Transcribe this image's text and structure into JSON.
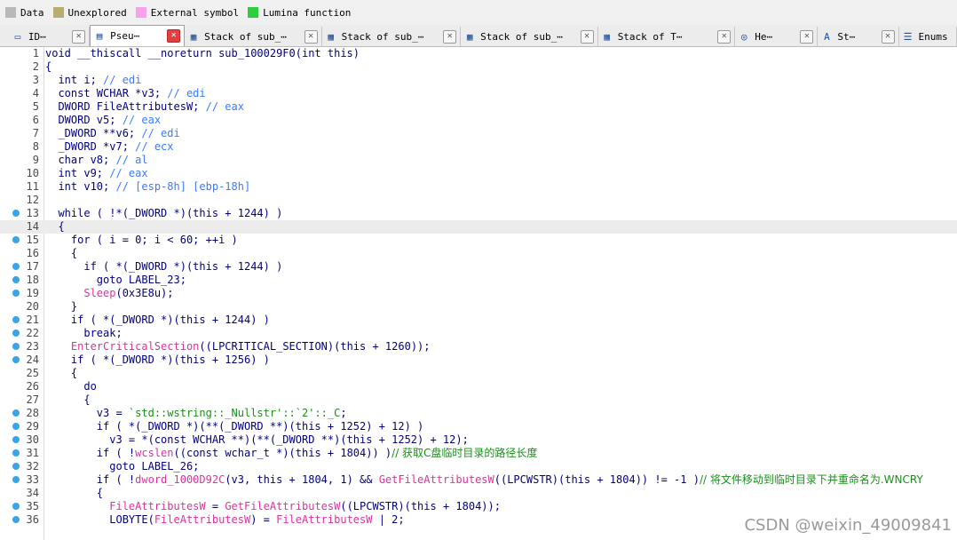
{
  "legend": [
    {
      "label": "Data",
      "color": "#b9b9b9"
    },
    {
      "label": "Unexplored",
      "color": "#b8ad6e"
    },
    {
      "label": "External symbol",
      "color": "#f7a0f0"
    },
    {
      "label": "Lumina function",
      "color": "#2ecc40"
    }
  ],
  "tabs": [
    {
      "label": "ID⋯",
      "icon": "ida-view-icon",
      "active": false
    },
    {
      "label": "Pseu⋯",
      "icon": "pseudocode-icon",
      "active": true
    },
    {
      "label": "Stack of sub_⋯",
      "icon": "stack-icon",
      "active": false
    },
    {
      "label": "Stack of sub_⋯",
      "icon": "stack-icon",
      "active": false
    },
    {
      "label": "Stack of sub_⋯",
      "icon": "stack-icon",
      "active": false
    },
    {
      "label": "Stack of T⋯",
      "icon": "stack-icon",
      "active": false
    },
    {
      "label": "He⋯",
      "icon": "hex-view-icon",
      "active": false
    },
    {
      "label": "St⋯",
      "icon": "strings-icon",
      "active": false
    },
    {
      "label": "Enums",
      "icon": "enums-icon",
      "active": false
    }
  ],
  "code_lines": [
    {
      "n": "1",
      "dot": false,
      "hl": false,
      "text": "void __thiscall __noreturn sub_100029F0(int this)"
    },
    {
      "n": "2",
      "dot": false,
      "hl": false,
      "text": "{"
    },
    {
      "n": "3",
      "dot": false,
      "hl": false,
      "text": "  int i; ",
      "cmt": "// edi"
    },
    {
      "n": "4",
      "dot": false,
      "hl": false,
      "text": "  const WCHAR *v3; ",
      "cmt": "// edi"
    },
    {
      "n": "5",
      "dot": false,
      "hl": false,
      "text": "  DWORD FileAttributesW; ",
      "cmt": "// eax"
    },
    {
      "n": "6",
      "dot": false,
      "hl": false,
      "text": "  DWORD v5; ",
      "cmt": "// eax"
    },
    {
      "n": "7",
      "dot": false,
      "hl": false,
      "text": "  _DWORD **v6; ",
      "cmt": "// edi"
    },
    {
      "n": "8",
      "dot": false,
      "hl": false,
      "text": "  _DWORD *v7; ",
      "cmt": "// ecx"
    },
    {
      "n": "9",
      "dot": false,
      "hl": false,
      "text": "  char v8; ",
      "cmt": "// al"
    },
    {
      "n": "10",
      "dot": false,
      "hl": false,
      "text": "  int v9; ",
      "cmt": "// eax"
    },
    {
      "n": "11",
      "dot": false,
      "hl": false,
      "text": "  int v10; ",
      "cmt": "// [esp-8h] [ebp-18h]"
    },
    {
      "n": "12",
      "dot": false,
      "hl": false,
      "text": ""
    },
    {
      "n": "13",
      "dot": true,
      "hl": false,
      "text": "  while ( !*(_DWORD *)(this + 1244) )"
    },
    {
      "n": "14",
      "dot": false,
      "hl": true,
      "text": "  {"
    },
    {
      "n": "15",
      "dot": true,
      "hl": false,
      "text": "    for ( i = 0; i < 60; ++i )"
    },
    {
      "n": "16",
      "dot": false,
      "hl": false,
      "text": "    {"
    },
    {
      "n": "17",
      "dot": true,
      "hl": false,
      "text": "      if ( *(_DWORD *)(this + 1244) )"
    },
    {
      "n": "18",
      "dot": true,
      "hl": false,
      "text": "        goto LABEL_23;"
    },
    {
      "n": "19",
      "dot": true,
      "hl": false,
      "pre": "      ",
      "fn": "Sleep",
      "text": "(0x3E8u);"
    },
    {
      "n": "20",
      "dot": false,
      "hl": false,
      "text": "    }"
    },
    {
      "n": "21",
      "dot": true,
      "hl": false,
      "text": "    if ( *(_DWORD *)(this + 1244) )"
    },
    {
      "n": "22",
      "dot": true,
      "hl": false,
      "text": "      break;"
    },
    {
      "n": "23",
      "dot": true,
      "hl": false,
      "pre": "    ",
      "fn": "EnterCriticalSection",
      "text": "((LPCRITICAL_SECTION)(this + 1260));"
    },
    {
      "n": "24",
      "dot": true,
      "hl": false,
      "text": "    if ( *(_DWORD *)(this + 1256) )"
    },
    {
      "n": "25",
      "dot": false,
      "hl": false,
      "text": "    {"
    },
    {
      "n": "26",
      "dot": false,
      "hl": false,
      "text": "      do"
    },
    {
      "n": "27",
      "dot": false,
      "hl": false,
      "text": "      {"
    },
    {
      "n": "28",
      "dot": true,
      "hl": false,
      "text": "        v3 = ",
      "str": "`std::wstring::_Nullstr'::`2'::_C",
      "tail": ";"
    },
    {
      "n": "29",
      "dot": true,
      "hl": false,
      "text": "        if ( *(_DWORD *)(**(_DWORD **)(this + 1252) + 12) )"
    },
    {
      "n": "30",
      "dot": true,
      "hl": false,
      "text": "          v3 = *(const WCHAR **)(**(_DWORD **)(this + 1252) + 12);"
    },
    {
      "n": "31",
      "dot": true,
      "hl": false,
      "pre": "        if ( !",
      "fn": "wcslen",
      "text": "((const wchar_t *)(this + 1804)) )",
      "zh": "// 获取C盘临时目录的路径长度"
    },
    {
      "n": "32",
      "dot": true,
      "hl": false,
      "text": "          goto LABEL_26;"
    },
    {
      "n": "33",
      "dot": true,
      "hl": false,
      "pre": "        if ( !",
      "fn": "dword_1000D92C",
      "text": "(v3, this + 1804, 1) && ",
      "fn2": "GetFileAttributesW",
      "text2": "((LPCWSTR)(this + 1804)) != -1 )",
      "zh": "// 将文件移动到临时目录下并重命名为.WNCRY"
    },
    {
      "n": "34",
      "dot": false,
      "hl": false,
      "text": "        {"
    },
    {
      "n": "35",
      "dot": true,
      "hl": false,
      "pre": "          ",
      "fn": "FileAttributesW",
      "text": " = ",
      "fn2": "GetFileAttributesW",
      "text2": "((LPCWSTR)(this + 1804));"
    },
    {
      "n": "36",
      "dot": true,
      "hl": false,
      "pre": "          LOBYTE(",
      "fn": "FileAttributesW",
      "text": ") = ",
      "fn2": "FileAttributesW",
      "text2": " | 2;"
    }
  ],
  "watermark": "CSDN @weixin_49009841"
}
